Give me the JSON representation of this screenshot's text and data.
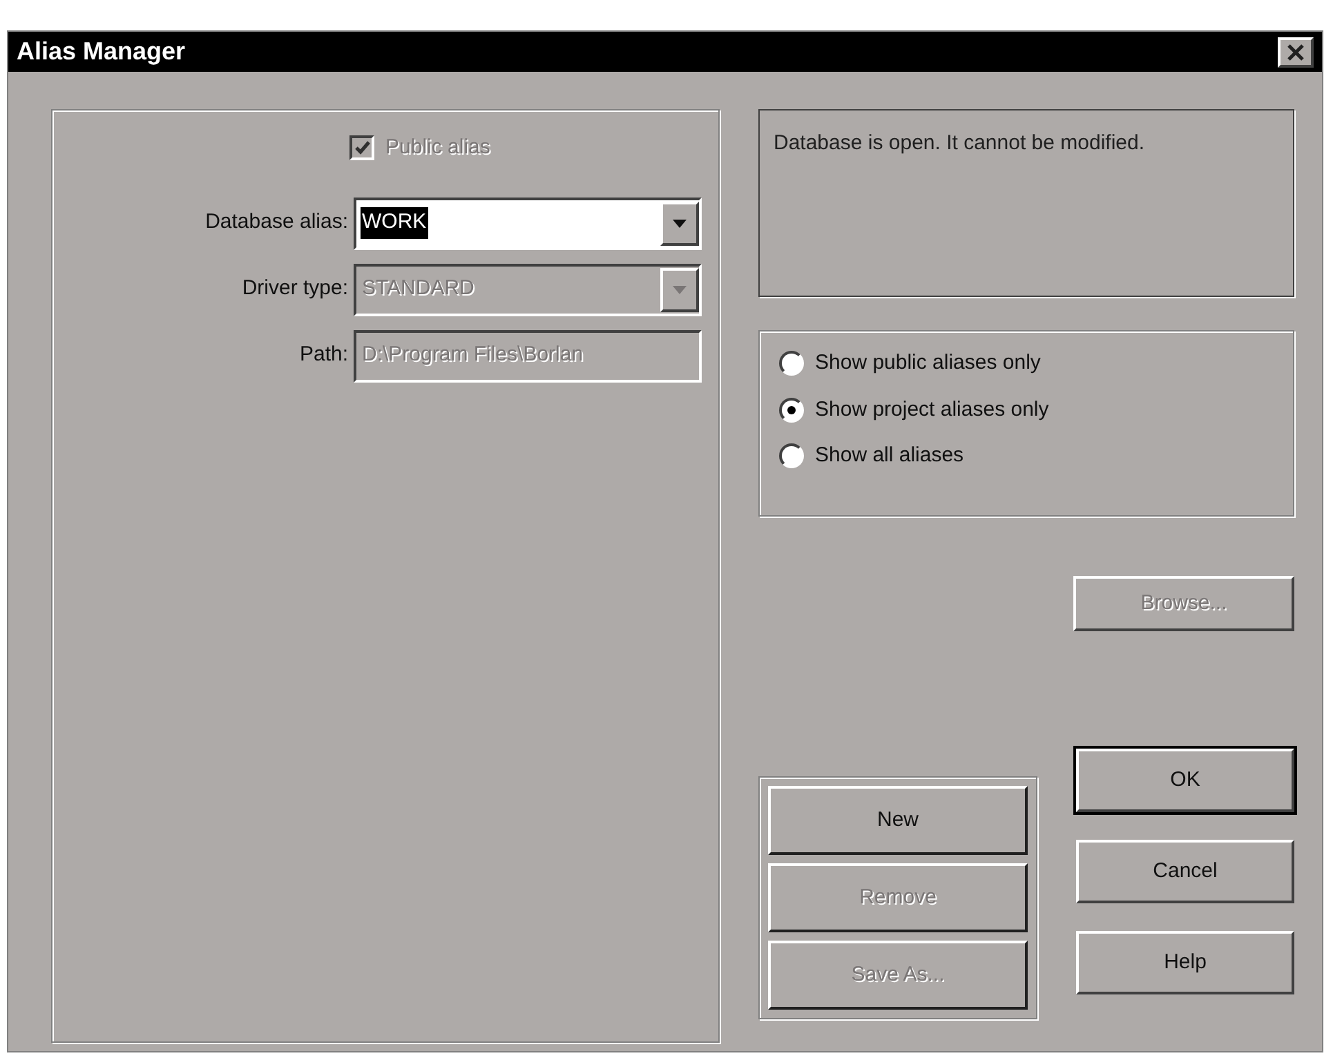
{
  "window": {
    "title": "Alias Manager"
  },
  "public_alias": {
    "label": "Public alias",
    "checked": true,
    "disabled": true
  },
  "fields": [
    {
      "label": "Database alias:",
      "value": "WORK",
      "kind": "combo",
      "disabled": false,
      "value_selected": true
    },
    {
      "label": "Driver type:",
      "value": "STANDARD",
      "kind": "combo",
      "disabled": true,
      "value_selected": false
    },
    {
      "label": "Path:",
      "value": "D:\\Program Files\\Borlan",
      "kind": "text",
      "disabled": true,
      "value_selected": false
    }
  ],
  "message": "Database is open. It cannot be modified.",
  "filter_options": [
    {
      "label": "Show public aliases only",
      "selected": false
    },
    {
      "label": "Show project aliases only",
      "selected": true
    },
    {
      "label": "Show all aliases",
      "selected": false
    }
  ],
  "browse_button": {
    "label": "Browse...",
    "disabled": true
  },
  "alias_buttons": [
    {
      "label": "New",
      "disabled": false
    },
    {
      "label": "Remove",
      "disabled": true
    },
    {
      "label": "Save As...",
      "disabled": true
    }
  ],
  "dialog_buttons": [
    {
      "label": "OK",
      "default": true
    },
    {
      "label": "Cancel",
      "default": false
    },
    {
      "label": "Help",
      "default": false
    }
  ]
}
